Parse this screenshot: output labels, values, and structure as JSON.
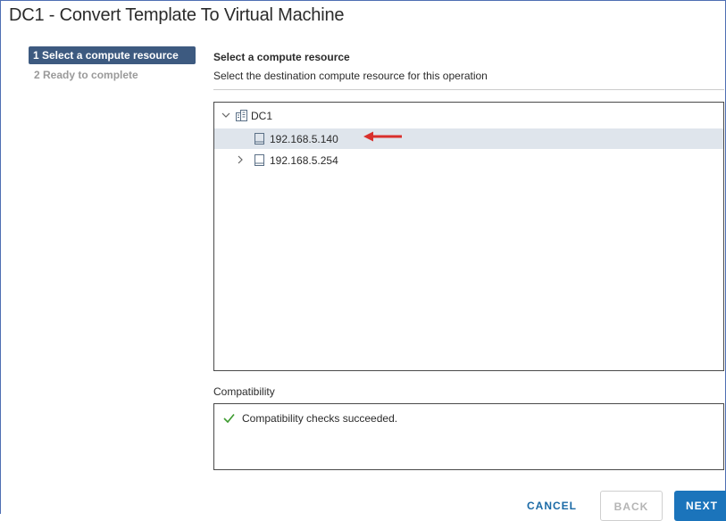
{
  "window": {
    "title": "DC1 - Convert Template To Virtual Machine"
  },
  "wizard": {
    "steps": [
      {
        "label": "1 Select a compute resource",
        "active": true
      },
      {
        "label": "2 Ready to complete",
        "active": false
      }
    ]
  },
  "main": {
    "section_title": "Select a compute resource",
    "section_subtitle": "Select the destination compute resource for this operation",
    "tree": {
      "root": {
        "label": "DC1",
        "icon": "datacenter-icon",
        "expanded": true
      },
      "items": [
        {
          "label": "192.168.5.140",
          "icon": "host-icon",
          "selected": true,
          "expandable": false
        },
        {
          "label": "192.168.5.254",
          "icon": "host-icon",
          "selected": false,
          "expandable": true
        }
      ]
    },
    "annotation": {
      "icon": "red-arrow-icon",
      "color": "#d9302c"
    },
    "compatibility": {
      "label": "Compatibility",
      "message": "Compatibility checks succeeded.",
      "status_color": "#3c9a2e"
    }
  },
  "footer": {
    "cancel_label": "CANCEL",
    "back_label": "BACK",
    "next_label": "NEXT"
  },
  "colors": {
    "accent": "#1b74bb",
    "step_active_bg": "#3d5a80",
    "selection_bg": "#dfe5ec"
  }
}
